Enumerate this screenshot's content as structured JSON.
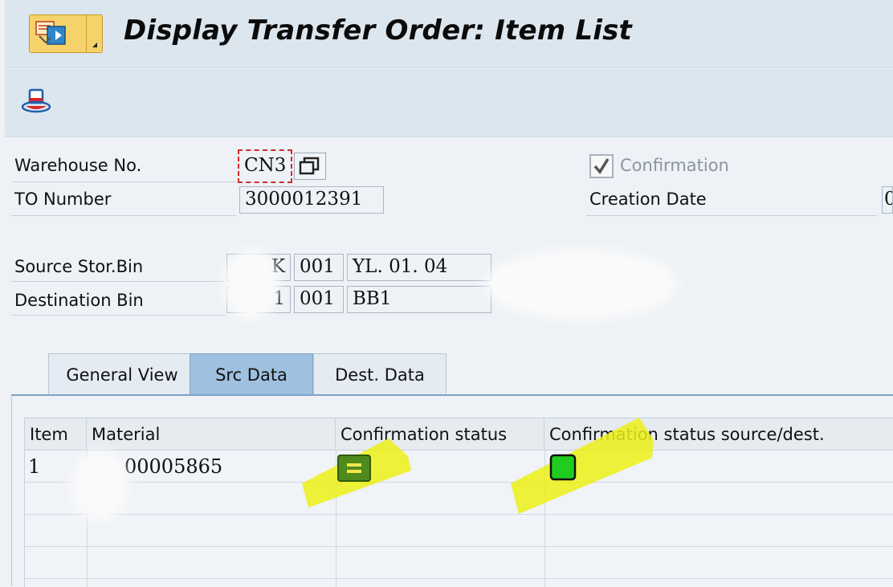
{
  "window": {
    "title": "Display Transfer Order: Item List"
  },
  "toolbar": {
    "display_icon": "display-hat-icon"
  },
  "header": {
    "warehouse_label": "Warehouse No.",
    "warehouse_value": "CN3",
    "to_number_label": "TO Number",
    "to_number_value": "3000012391",
    "confirmation_label": "Confirmation",
    "confirmation_checked": true,
    "creation_date_label": "Creation Date",
    "creation_date_value": "0"
  },
  "bins": {
    "source_label": "Source Stor.Bin",
    "source_type_partial": "K",
    "source_section": "001",
    "source_bin": "YL. 01. 04",
    "dest_label": "Destination Bin",
    "dest_type_partial": "1",
    "dest_section": "001",
    "dest_bin": "BB1"
  },
  "tabs": [
    {
      "label": "General View",
      "active": false
    },
    {
      "label": "Src Data",
      "active": true
    },
    {
      "label": "Dest. Data",
      "active": false
    }
  ],
  "table": {
    "columns": [
      "Item",
      "Material",
      "Confirmation status",
      "Confirmation status source/dest."
    ],
    "rows": [
      {
        "item": "1",
        "material": "00005865",
        "confirmation_status": "equal-status-icon",
        "source_dest_status": "green-status-icon"
      }
    ]
  },
  "colors": {
    "highlight": "#ecf016",
    "status_green": "#1fcc1f",
    "status_dark_green": "#4f8a1c",
    "tab_active": "#9fc0df"
  }
}
